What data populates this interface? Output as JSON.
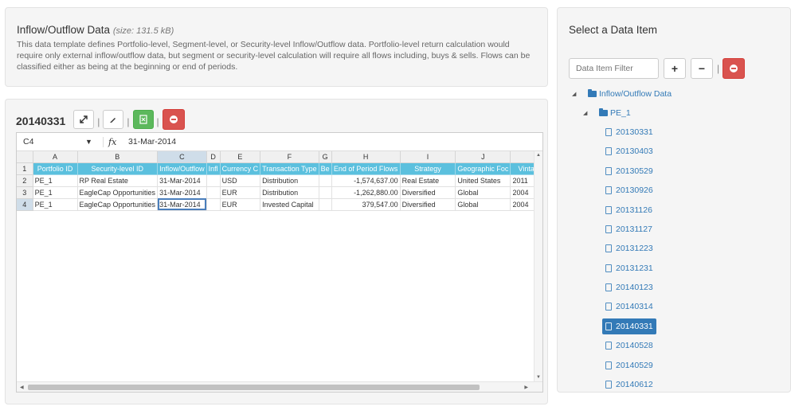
{
  "info": {
    "title": "Inflow/Outflow Data",
    "size": "(size: 131.5 kB)",
    "description": "This data template defines Portfolio-level, Segment-level, or Security-level Inflow/Outflow data. Portfolio-level return calculation would require only external inflow/outflow data, but segment or security-level calculation will require all flows including, buys & sells. Flows can be classified either as being at the beginning or end of periods."
  },
  "sheet": {
    "date": "20140331",
    "cell_ref": "C4",
    "fx_label": "fx",
    "formula_value": "31-Mar-2014",
    "columns": [
      "A",
      "B",
      "C",
      "D",
      "E",
      "F",
      "G",
      "H",
      "I",
      "J",
      ""
    ],
    "row_numbers": [
      "1",
      "2",
      "3",
      "4"
    ],
    "header_row": [
      "Portfolio ID",
      "Security-level ID",
      "Inflow/Outflow",
      "Infl",
      "Currency C",
      "Transaction Type",
      "Be",
      "End of Period Flows",
      "Strategy",
      "Geographic Foc",
      "Vinta"
    ],
    "rows": [
      [
        "PE_1",
        "RP Real Estate",
        "31-Mar-2014",
        "",
        "USD",
        "Distribution",
        "",
        "-1,574,637.00",
        "Real Estate",
        "United States",
        "2011"
      ],
      [
        "PE_1",
        "EagleCap Opportunities",
        "31-Mar-2014",
        "",
        "EUR",
        "Distribution",
        "",
        "-1,262,880.00",
        "Diversified",
        "Global",
        "2004"
      ],
      [
        "PE_1",
        "EagleCap Opportunities",
        "31-Mar-2014",
        "",
        "EUR",
        "Invested Capital",
        "",
        "379,547.00",
        "Diversified",
        "Global",
        "2004"
      ]
    ]
  },
  "tree": {
    "title": "Select a Data Item",
    "filter_placeholder": "Data Item Filter",
    "root": "Inflow/Outflow Data",
    "child": "PE_1",
    "items": [
      "20130331",
      "20130403",
      "20130529",
      "20130926",
      "20131126",
      "20131127",
      "20131223",
      "20131231",
      "20140123",
      "20140314",
      "20140331",
      "20140528",
      "20140529",
      "20140612"
    ],
    "selected": "20140331"
  },
  "icons": {
    "expand": "expand-icon",
    "edit": "pencil-icon",
    "export": "excel-icon",
    "delete": "minus-circle-icon"
  },
  "colors": {
    "header_blue": "#5bc0de",
    "selected_blue": "#337ab7",
    "danger_red": "#d9534f",
    "success_green": "#5cb85c"
  }
}
